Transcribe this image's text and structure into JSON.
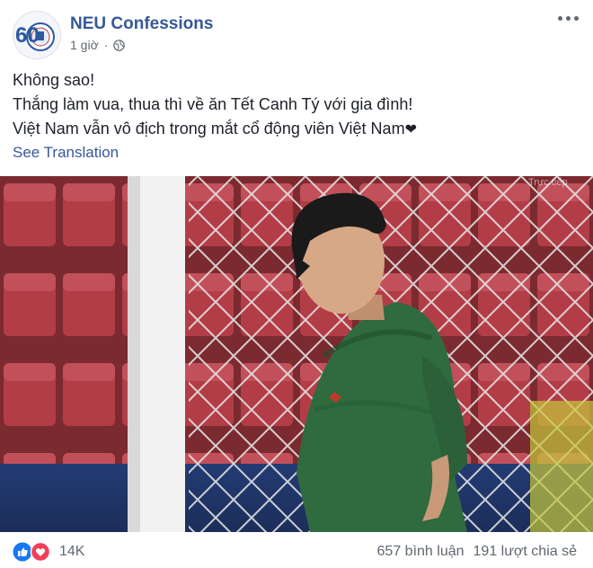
{
  "post": {
    "page_name": "NEU Confessions",
    "time": "1 giờ",
    "privacy_icon": "globe-icon",
    "lines": [
      "Không sao!",
      "Thắng làm vua, thua thì về ăn Tết Canh Tý với gia đình!",
      "Việt Nam vẫn vô địch trong mắt cổ động viên Việt Nam"
    ],
    "heart_char": "❤",
    "see_translation": "See Translation",
    "photo_watermark": "Trực tiếp",
    "avatar_numeral": "60"
  },
  "footer": {
    "reaction_icons": [
      "like-icon",
      "love-icon"
    ],
    "reaction_count": "14K",
    "comments": "657 bình luận",
    "shares": "191 lượt chia sẻ"
  },
  "colors": {
    "link": "#365899",
    "like_blue": "#1877f2",
    "love_red": "#f33e58",
    "jersey_green": "#2f6b3e",
    "stadium_red": "#8a2f36"
  }
}
